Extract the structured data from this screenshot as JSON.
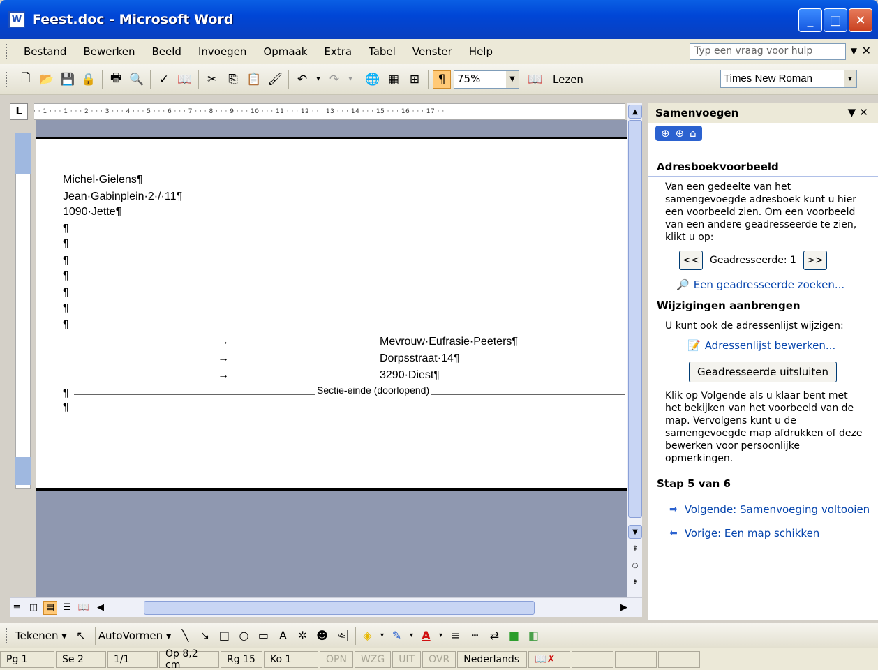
{
  "window": {
    "title": "Feest.doc - Microsoft Word",
    "minimize": "_",
    "maximize": "□",
    "close": "✕"
  },
  "menu": {
    "items": [
      "Bestand",
      "Bewerken",
      "Beeld",
      "Invoegen",
      "Opmaak",
      "Extra",
      "Tabel",
      "Venster",
      "Help"
    ],
    "help_placeholder": "Typ een vraag voor hulp"
  },
  "toolbar": {
    "zoom": "75%",
    "read_label": "Lezen",
    "font": "Times New Roman"
  },
  "ruler": {
    "corner": "L",
    "ticks": "· · 1 · · · 1 · · · 2 · · · 3 · · · 4 · · · 5 · · · 6 · · · 7 · · · 8 · · · 9 · · · 10 · · · 11 · · · 12 · · · 13 · · · 14 · · · 15 · · · 16 · · · 17 · ·"
  },
  "document": {
    "sender": [
      "Michel·Gielens¶",
      "Jean·Gabinplein·2·/·11¶",
      "1090·Jette¶"
    ],
    "empty_paragraphs": [
      "¶",
      "¶",
      "¶",
      "¶",
      "¶",
      "¶",
      "¶"
    ],
    "recipient": [
      "Mevrouw·Eufrasie·Peeters¶",
      "Dorpsstraat·14¶",
      "3290·Diest¶"
    ],
    "tab_arrow": "→",
    "section_break": "Sectie-einde (doorlopend)",
    "pilcrow": "¶"
  },
  "taskpane": {
    "title": "Samenvoegen",
    "section1_title": "Adresboekvoorbeeld",
    "section1_text": "Van een gedeelte van het samengevoegde adresboek kunt u hier een voorbeeld zien. Om een voorbeeld van een andere geadresseerde te zien, klikt u op:",
    "prev_btn": "<<",
    "next_btn": ">>",
    "recipient_label": "Geadresseerde: 1",
    "find_link": "Een geadresseerde zoeken...",
    "section2_title": "Wijzigingen aanbrengen",
    "section2_text": "U kunt ook de adressenlijst wijzigen:",
    "edit_link": "Adressenlijst bewerken...",
    "exclude_btn": "Geadresseerde uitsluiten",
    "section2_text2": "Klik op Volgende als u klaar bent met het bekijken van het voorbeeld van de map. Vervolgens kunt u de samengevoegde map afdrukken of deze bewerken voor persoonlijke opmerkingen.",
    "step_title": "Stap 5 van 6",
    "next_step": "Volgende: Samenvoeging voltooien",
    "prev_step": "Vorige: Een map schikken"
  },
  "drawbar": {
    "draw_label": "Tekenen",
    "autoshapes_label": "AutoVormen"
  },
  "status": {
    "page": "Pg 1",
    "section": "Se 2",
    "pages": "1/1",
    "position": "Op 8,2 cm",
    "line": "Rg 15",
    "column": "Ko 1",
    "rec": "OPN",
    "trk": "WZG",
    "ext": "UIT",
    "ovr": "OVR",
    "language": "Nederlands"
  }
}
